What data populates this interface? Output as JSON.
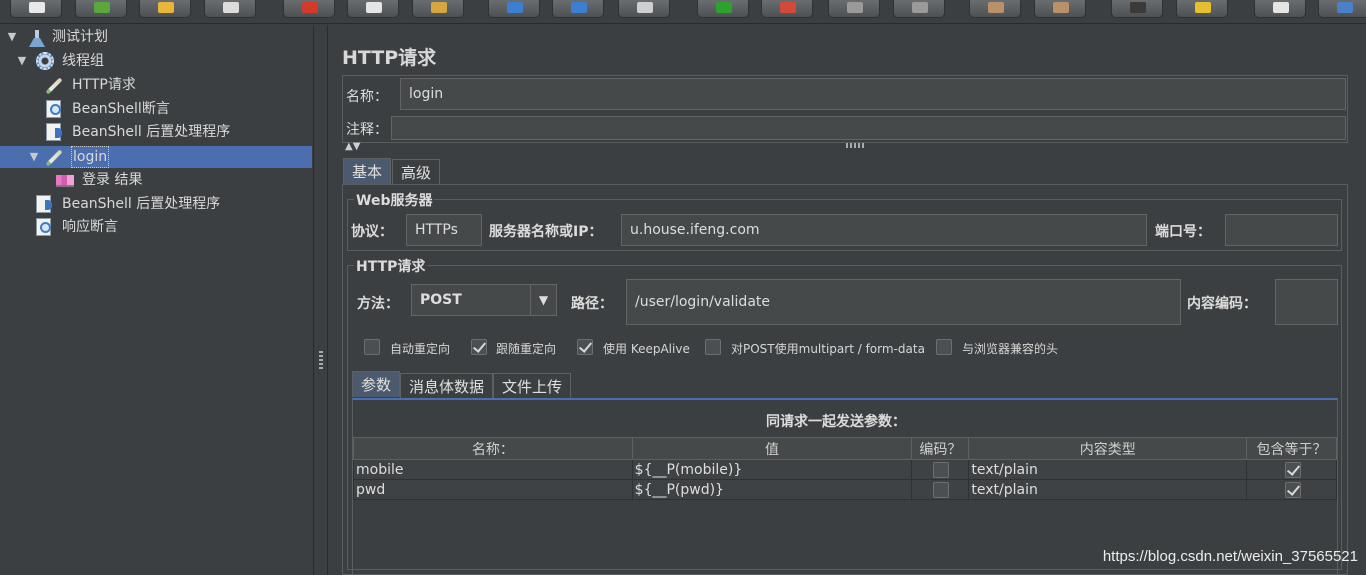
{
  "toolbar": {
    "buttons": [
      {
        "name": "new-icon",
        "color": "#e9e9e9"
      },
      {
        "name": "templates-icon",
        "color": "#5aa83b"
      },
      {
        "name": "open-icon",
        "color": "#e8b63a"
      },
      {
        "name": "save-icon",
        "color": "#dcdcdc"
      },
      {
        "name": "cut-icon",
        "color": "#d23b2a"
      },
      {
        "name": "copy-icon",
        "color": "#e5e5e5"
      },
      {
        "name": "paste-icon",
        "color": "#d6a640"
      },
      {
        "name": "expand-icon",
        "color": "#3c7fd1"
      },
      {
        "name": "collapse-icon",
        "color": "#3c7fd1"
      },
      {
        "name": "toggle-icon",
        "color": "#cfcfcf"
      },
      {
        "name": "start-icon",
        "color": "#2fa12f"
      },
      {
        "name": "start-no-pause-icon",
        "color": "#d44a3a"
      },
      {
        "name": "stop-icon",
        "color": "#9a9a9a"
      },
      {
        "name": "shutdown-icon",
        "color": "#9a9a9a"
      },
      {
        "name": "clear-icon",
        "color": "#b8916a"
      },
      {
        "name": "clear-all-icon",
        "color": "#b8916a"
      },
      {
        "name": "search-icon",
        "color": "#3a3a3a"
      },
      {
        "name": "reset-search-icon",
        "color": "#e7c02f"
      },
      {
        "name": "function-helper-icon",
        "color": "#e5e5e5"
      },
      {
        "name": "help-icon",
        "color": "#4a80c8"
      }
    ]
  },
  "tree": {
    "nodes": [
      {
        "label": "测试计划",
        "icon": "flask-icon",
        "expanded": true
      },
      {
        "label": "线程组",
        "icon": "gear-icon",
        "expanded": true
      },
      {
        "label": "HTTP请求",
        "icon": "pencil-icon"
      },
      {
        "label": "BeanShell断言",
        "icon": "magnifier-doc-icon"
      },
      {
        "label": "BeanShell 后置处理程序",
        "icon": "doc-icon"
      },
      {
        "label": "login",
        "icon": "pencil-icon",
        "expanded": true,
        "selected": true
      },
      {
        "label": "登录 结果",
        "icon": "chart-icon"
      },
      {
        "label": "BeanShell 后置处理程序",
        "icon": "doc-icon"
      },
      {
        "label": "响应断言",
        "icon": "magnifier-doc-icon"
      }
    ]
  },
  "panel": {
    "title": "HTTP请求",
    "name_label": "名称：",
    "name_value": "login",
    "comment_label": "注释：",
    "comment_value": "",
    "tabs": [
      {
        "label": "基本",
        "active": true
      },
      {
        "label": "高级",
        "active": false
      }
    ],
    "web_server": {
      "legend": "Web服务器",
      "protocol_label": "协议：",
      "protocol_value": "HTTPs",
      "server_label": "服务器名称或IP：",
      "server_value": "u.house.ifeng.com",
      "port_label": "端口号：",
      "port_value": ""
    },
    "http_request": {
      "legend": "HTTP请求",
      "method_label": "方法：",
      "method_value": "POST",
      "path_label": "路径：",
      "path_value": "/user/login/validate",
      "encoding_label": "内容编码：",
      "encoding_value": "",
      "checkboxes": [
        {
          "label": "自动重定向",
          "checked": false
        },
        {
          "label": "跟随重定向",
          "checked": true
        },
        {
          "label": "使用 KeepAlive",
          "checked": true
        },
        {
          "label": "对POST使用multipart / form-data",
          "checked": false
        },
        {
          "label": "与浏览器兼容的头",
          "checked": false
        }
      ]
    },
    "sub_tabs": [
      {
        "label": "参数",
        "active": true
      },
      {
        "label": "消息体数据",
        "active": false
      },
      {
        "label": "文件上传",
        "active": false
      }
    ],
    "params_caption": "同请求一起发送参数：",
    "table": {
      "headers": [
        "名称：",
        "值",
        "编码？",
        "内容类型",
        "包含等于？"
      ],
      "rows": [
        {
          "name": "mobile",
          "value": "${__P(mobile)}",
          "encode": false,
          "content_type": "text/plain",
          "include_equals": true
        },
        {
          "name": "pwd",
          "value": "${__P(pwd)}",
          "encode": false,
          "content_type": "text/plain",
          "include_equals": true
        }
      ]
    }
  },
  "watermark": "https://blog.csdn.net/weixin_37565521"
}
